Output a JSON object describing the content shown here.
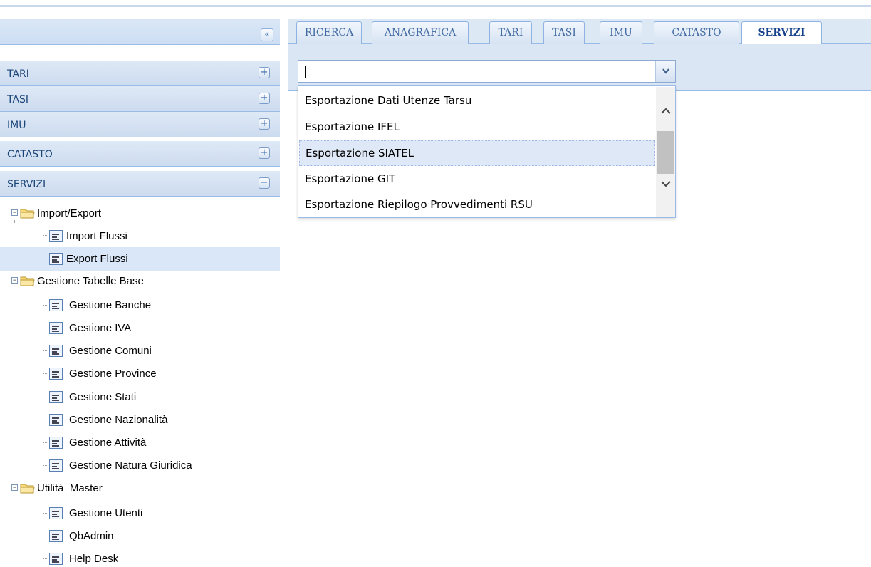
{
  "west": {
    "collapse_glyph": "«",
    "accordion": [
      {
        "label": "TARI",
        "toggle": "+"
      },
      {
        "label": "TASI",
        "toggle": "+"
      },
      {
        "label": "IMU",
        "toggle": "+"
      },
      {
        "label": "CATASTO",
        "toggle": "+"
      },
      {
        "label": "SERVIZI",
        "toggle": "−"
      }
    ],
    "tree": {
      "import_export": {
        "label": "Import/Export",
        "children": [
          "Import Flussi",
          "Export Flussi"
        ]
      },
      "tabelle_base": {
        "label": "Gestione Tabelle Base",
        "children": [
          "Gestione Banche",
          "Gestione IVA",
          "Gestione Comuni",
          "Gestione Province",
          "Gestione Stati",
          "Gestione Nazionalità",
          "Gestione Attività",
          "Gestione Natura Giuridica"
        ]
      },
      "utilita_master": {
        "label": "Utilità  Master",
        "children": [
          "Gestione Utenti",
          "QbAdmin",
          "Help Desk"
        ]
      },
      "selected": "Export Flussi"
    }
  },
  "tabs": [
    "RICERCA",
    "ANAGRAFICA",
    "TARI",
    "TASI",
    "IMU",
    "CATASTO",
    "SERVIZI"
  ],
  "active_tab": "SERVIZI",
  "combo": {
    "value": "",
    "trigger_icon": "chevron-down-icon"
  },
  "dropdown": {
    "options": [
      "Esportazione Dati Utenze Tarsu",
      "Esportazione IFEL",
      "Esportazione SIATEL",
      "Esportazione GIT",
      "Esportazione Riepilogo Provvedimenti RSU"
    ],
    "highlighted": "Esportazione SIATEL"
  },
  "colors": {
    "panel_header": "#dae6f4",
    "border": "#99bbe8",
    "selected_row": "#d9e7f8",
    "text_blue": "#15428b"
  }
}
